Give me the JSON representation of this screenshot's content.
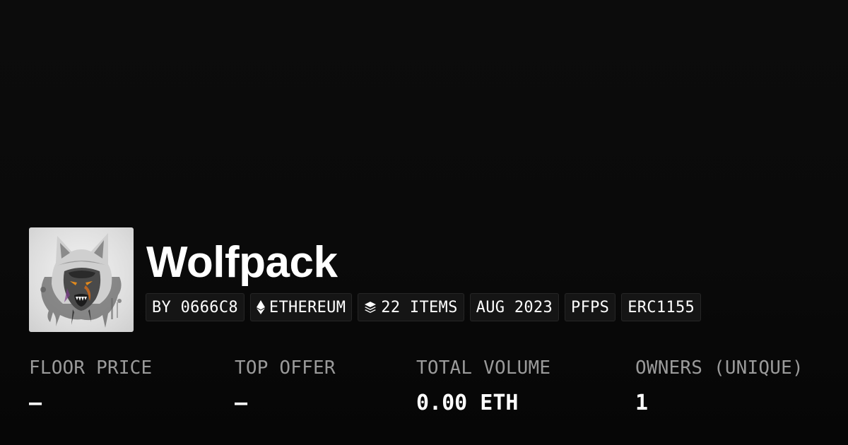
{
  "collection": {
    "name": "Wolfpack",
    "thumbnail_icon": "wolf-artwork"
  },
  "tags": {
    "creator": "BY 0666C8",
    "chain": "ETHEREUM",
    "chain_icon": "ethereum-icon",
    "items": "22 ITEMS",
    "items_icon": "layers-icon",
    "date": "AUG 2023",
    "category": "PFPS",
    "standard": "ERC1155"
  },
  "stats": [
    {
      "label": "FLOOR PRICE",
      "value": "–"
    },
    {
      "label": "TOP OFFER",
      "value": "–"
    },
    {
      "label": "TOTAL VOLUME",
      "value": "0.00 ETH"
    },
    {
      "label": "OWNERS (UNIQUE)",
      "value": "1"
    }
  ],
  "colors": {
    "background": "#0a0a0a",
    "tag_background": "#151515",
    "label": "#9a9a9a",
    "text": "#ffffff",
    "accent_eye": "#e08a1e"
  }
}
